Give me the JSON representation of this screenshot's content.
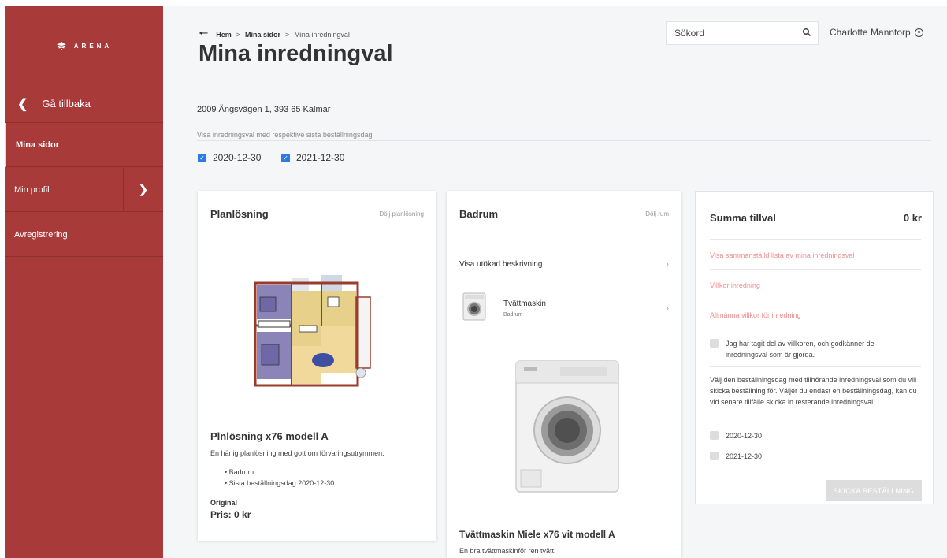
{
  "sidebar": {
    "logo_text": "ARENA",
    "back_label": "Gå tillbaka",
    "items": [
      {
        "label": "Mina sidor"
      },
      {
        "label": "Min profil"
      },
      {
        "label": "Avregistrering"
      }
    ]
  },
  "header": {
    "breadcrumb": [
      "Hem",
      "Mina sidor",
      "Mina inredningval"
    ],
    "breadcrumb_sep": ">",
    "title": "Mina inredningval",
    "search_placeholder": "Sökord",
    "user_name": "Charlotte Manntorp"
  },
  "main": {
    "address": "2009 Ängsvägen 1, 393 65 Kalmar",
    "filter_label": "Visa inredningsval med respektive sista beställningsdag",
    "filters": [
      {
        "label": "2020-12-30",
        "checked": true
      },
      {
        "label": "2021-12-30",
        "checked": true
      }
    ]
  },
  "plan_card": {
    "title": "Planlösning",
    "hide_link": "Dölj planlösning",
    "model_title": "Plnlösning x76 modell A",
    "description": "En härlig planlösning med gott om förvaringsutrymmen.",
    "bullets": [
      "Badrum",
      "Sista beställningsdag 2020-12-30"
    ],
    "original_label": "Original",
    "price": "Pris: 0 kr"
  },
  "bath_card": {
    "title": "Badrum",
    "hide_link": "Dölj rum",
    "expand_label": "Visa utökad beskrivning",
    "item_name": "Tvättmaskin",
    "item_sub": "Badrum",
    "product_title": "Tvättmaskin Miele x76 vit modell A",
    "product_desc": "En bra tvättmaskinför ren tvätt."
  },
  "summary": {
    "title": "Summa tillval",
    "total": "0 kr",
    "links": [
      "Visa sammanställd lista av mina inredningsval",
      "Villkor inredning",
      "Allmänna villkor för inredning"
    ],
    "terms_label": "Jag har tagit del av villkoren, och godkänner de inredningsval som är gjorda.",
    "info": "Välj den beställningsdag med tillhörande inredningsval som du vill skicka beställning för. Väljer du endast en beställningsdag, kan du vid senare tillfälle skicka in resterande inredningsval",
    "dates": [
      "2020-12-30",
      "2021-12-30"
    ],
    "send_button": "SKICKA BESTÄLLNING"
  },
  "colors": {
    "accent": "#a83a3a",
    "link": "#f08f8f",
    "checkbox": "#2c7be5"
  }
}
